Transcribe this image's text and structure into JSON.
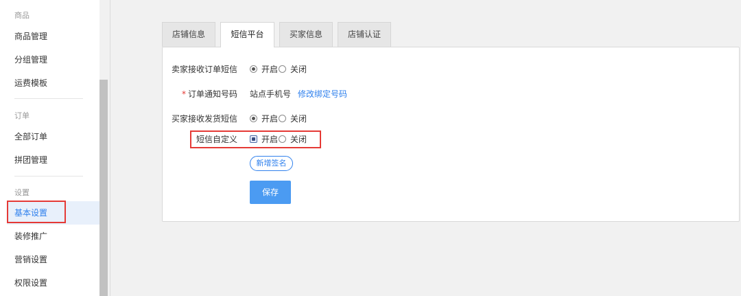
{
  "sidebar": {
    "sections": [
      {
        "header": "商品",
        "items": [
          "商品管理",
          "分组管理",
          "运费模板"
        ]
      },
      {
        "header": "订单",
        "items": [
          "全部订单",
          "拼团管理"
        ]
      },
      {
        "header": "设置",
        "items": [
          "基本设置",
          "装修推广",
          "营销设置",
          "权限设置"
        ]
      }
    ],
    "active_item": "基本设置"
  },
  "tabs": [
    {
      "label": "店铺信息",
      "active": false
    },
    {
      "label": "短信平台",
      "active": true
    },
    {
      "label": "买家信息",
      "active": false
    },
    {
      "label": "店铺认证",
      "active": false
    }
  ],
  "form": {
    "seller_sms": {
      "label": "卖家接收订单短信",
      "on_label": "开启",
      "off_label": "关闭",
      "selected": "开启"
    },
    "notify_number": {
      "required_mark": "*",
      "label": "订单通知号码",
      "value": "站点手机号",
      "link": "修改绑定号码"
    },
    "buyer_sms": {
      "label": "买家接收发货短信",
      "on_label": "开启",
      "off_label": "关闭",
      "selected": "开启"
    },
    "custom_sms": {
      "label": "短信自定义",
      "on_label": "开启",
      "off_label": "关闭",
      "selected": "开启"
    },
    "add_signature_button": "新增签名",
    "save_button": "保存"
  },
  "colors": {
    "accent": "#2f80ed",
    "primary_button": "#4b9bf2",
    "highlight_box": "#e53935",
    "active_nav_bg": "#e8f0fb"
  }
}
